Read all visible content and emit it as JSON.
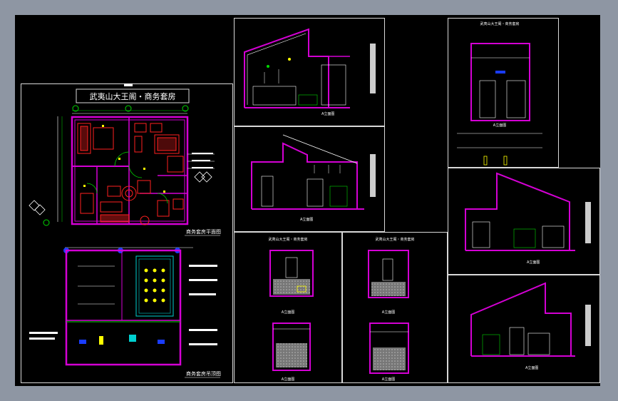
{
  "drawing": {
    "sheet_title": "武夷山大王阁・商务套房",
    "plan_label": "商务套房平面图",
    "ceiling_label": "商务套房吊顶图",
    "elevation_title": "武夷山大王阁・商务套房",
    "elevation_label": "A立面图"
  },
  "colors": {
    "background": "#8e96a3",
    "sheet": "#000000",
    "wall": "#d400d4",
    "red": "#ff2020",
    "cyan": "#00d0d0",
    "green": "#00d800",
    "blue": "#1a3cff",
    "yellow": "#ffff00",
    "white": "#ffffff",
    "gray": "#a8a8a8"
  }
}
